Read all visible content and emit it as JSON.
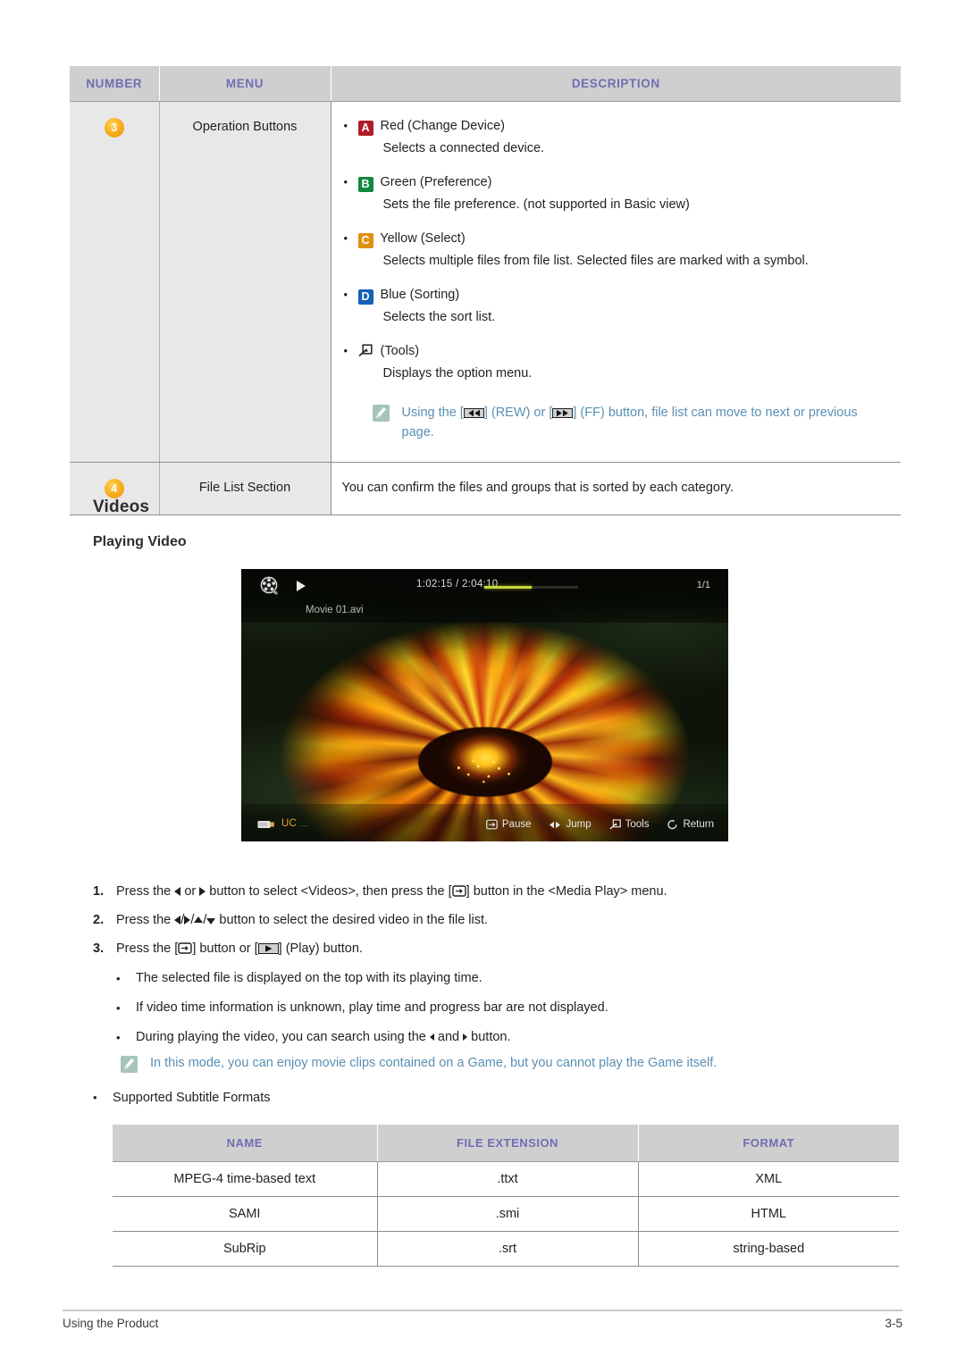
{
  "spec_table": {
    "headers": [
      "NUMBER",
      "MENU",
      "DESCRIPTION"
    ],
    "rows": [
      {
        "number": "3",
        "menu": "Operation Buttons",
        "items": [
          {
            "key": "A",
            "key_color": "#b01c28",
            "title": "Red (Change Device)",
            "desc": "Selects a connected device."
          },
          {
            "key": "B",
            "key_color": "#10883e",
            "title": "Green (Preference)",
            "desc": "Sets the file preference. (not supported in Basic view)"
          },
          {
            "key": "C",
            "key_color": "#e09010",
            "title": "Yellow (Select)",
            "desc": "Selects multiple files from file list. Selected files are marked with a symbol."
          },
          {
            "key": "D",
            "key_color": "#1461b8",
            "title": "Blue (Sorting)",
            "desc": "Selects the sort list."
          },
          {
            "key": "tools-icon",
            "key_color": "#231f20",
            "title": "(Tools)",
            "desc": "Displays the option menu."
          }
        ],
        "note": {
          "icon": "note-pencil-icon",
          "color": "#5a8fb4",
          "text_before": "Using the [",
          "rew_icon": "rewind-icon",
          "text_mid1": "] (REW) or [",
          "ff_icon": "fast-forward-icon",
          "text_mid2": "] (FF) button, file list can move to next or previous page."
        }
      },
      {
        "number": "4",
        "menu": "File List Section",
        "description": "You can confirm the files and groups that is sorted by each category."
      }
    ]
  },
  "section": {
    "title": "Videos",
    "subtitle": "Playing Video"
  },
  "video_player": {
    "reel_icon": "film-reel-icon",
    "play_icon": "play-icon",
    "timecode": "1:02:15 / 2:04:10",
    "progress_percent": 50,
    "progress_color": "#c8d83a",
    "page_indicator": "1/1",
    "file_name": "Movie 01.avi",
    "device_icon": "usb-device-icon",
    "device_name": "UC",
    "device_dots": "....",
    "device_name_color": "#e8a13c",
    "keys": [
      {
        "icon": "pause-enter-icon",
        "label": "Pause"
      },
      {
        "icon": "jump-arrows-icon",
        "label": "Jump"
      },
      {
        "icon": "tools-icon",
        "label": "Tools"
      },
      {
        "icon": "return-icon",
        "label": "Return"
      }
    ]
  },
  "steps": [
    {
      "n": "1.",
      "p1": "Press the",
      "p2": "or",
      "p3": "button to select <Videos>, then press the [",
      "p4": "] button in the <Media Play> menu."
    },
    {
      "n": "2.",
      "p1": "Press the",
      "p2": "button to select the desired video in the file list."
    },
    {
      "n": "3.",
      "p1": "Press the [",
      "p2": "] button or [",
      "p3": "] (Play) button."
    }
  ],
  "step_notes": [
    "The selected file is displayed on the top with its playing time.",
    "If video time information is unknown, play time and progress bar are not displayed.",
    "During playing the video, you can search using the"
  ],
  "step_note_tail": "and",
  "step_note_tail2": "button.",
  "game_note": {
    "icon": "note-pencil-icon",
    "color": "#5a8fb4",
    "text": "In this mode, you can enjoy movie clips contained on a Game, but you cannot play the Game itself."
  },
  "supported_label": "Supported Subtitle Formats",
  "subtitle_table": {
    "headers": [
      "NAME",
      "FILE EXTENSION",
      "FORMAT"
    ],
    "rows": [
      [
        "MPEG-4 time-based text",
        ".ttxt",
        "XML"
      ],
      [
        "SAMI",
        ".smi",
        "HTML"
      ],
      [
        "SubRip",
        ".srt",
        "string-based"
      ]
    ]
  },
  "footer": {
    "left": "Using the Product",
    "right": "3-5"
  },
  "colors": {
    "table_header_bg": "#cfcfcf",
    "table_header_text": "#6e6eb4",
    "cell_bg": "#e8e8e8",
    "badge": "#f7ab1a",
    "note_text": "#5a8fb4",
    "note_icon_bg": "#a7c4bc"
  },
  "bullet_char": "•"
}
